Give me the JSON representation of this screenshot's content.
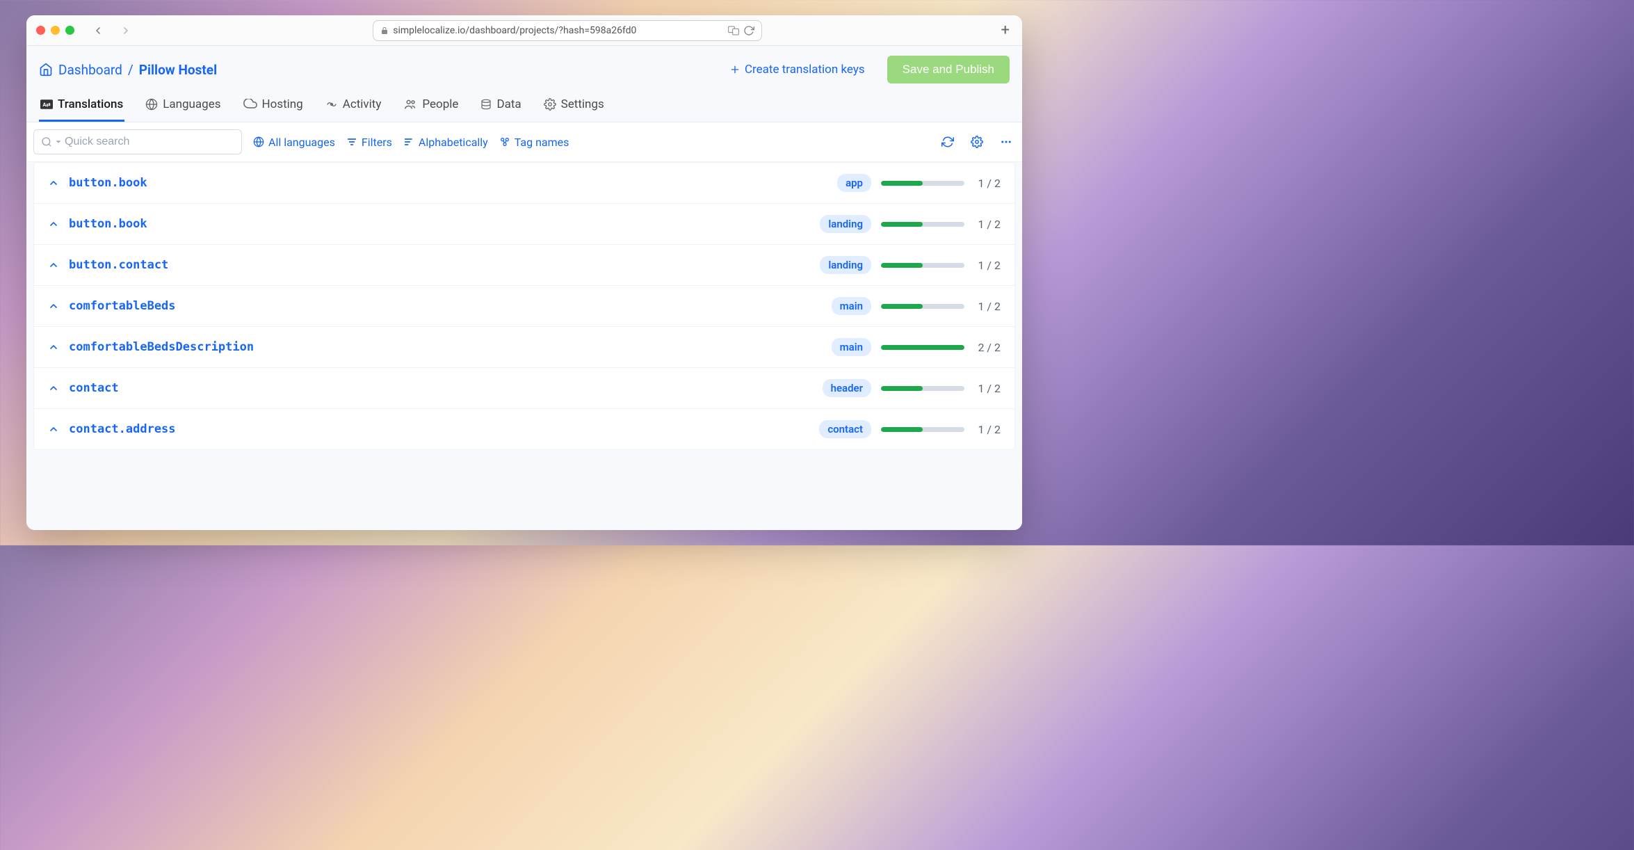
{
  "browser": {
    "url": "simplelocalize.io/dashboard/projects/?hash=598a26fd0"
  },
  "breadcrumb": {
    "dashboard": "Dashboard",
    "sep": "/",
    "project": "Pillow Hostel"
  },
  "actions": {
    "create_keys": "Create translation keys",
    "save_publish": "Save and Publish"
  },
  "tabs": [
    {
      "label": "Translations"
    },
    {
      "label": "Languages"
    },
    {
      "label": "Hosting"
    },
    {
      "label": "Activity"
    },
    {
      "label": "People"
    },
    {
      "label": "Data"
    },
    {
      "label": "Settings"
    }
  ],
  "toolbar": {
    "search_placeholder": "Quick search",
    "all_languages": "All languages",
    "filters": "Filters",
    "sort": "Alphabetically",
    "tag_names": "Tag names"
  },
  "keys": [
    {
      "name": "button.book",
      "tag": "app",
      "done": 1,
      "total": 2,
      "pct": 50
    },
    {
      "name": "button.book",
      "tag": "landing",
      "done": 1,
      "total": 2,
      "pct": 50
    },
    {
      "name": "button.contact",
      "tag": "landing",
      "done": 1,
      "total": 2,
      "pct": 50
    },
    {
      "name": "comfortableBeds",
      "tag": "main",
      "done": 1,
      "total": 2,
      "pct": 50
    },
    {
      "name": "comfortableBedsDescription",
      "tag": "main",
      "done": 2,
      "total": 2,
      "pct": 100
    },
    {
      "name": "contact",
      "tag": "header",
      "done": 1,
      "total": 2,
      "pct": 50
    },
    {
      "name": "contact.address",
      "tag": "contact",
      "done": 1,
      "total": 2,
      "pct": 50
    }
  ]
}
